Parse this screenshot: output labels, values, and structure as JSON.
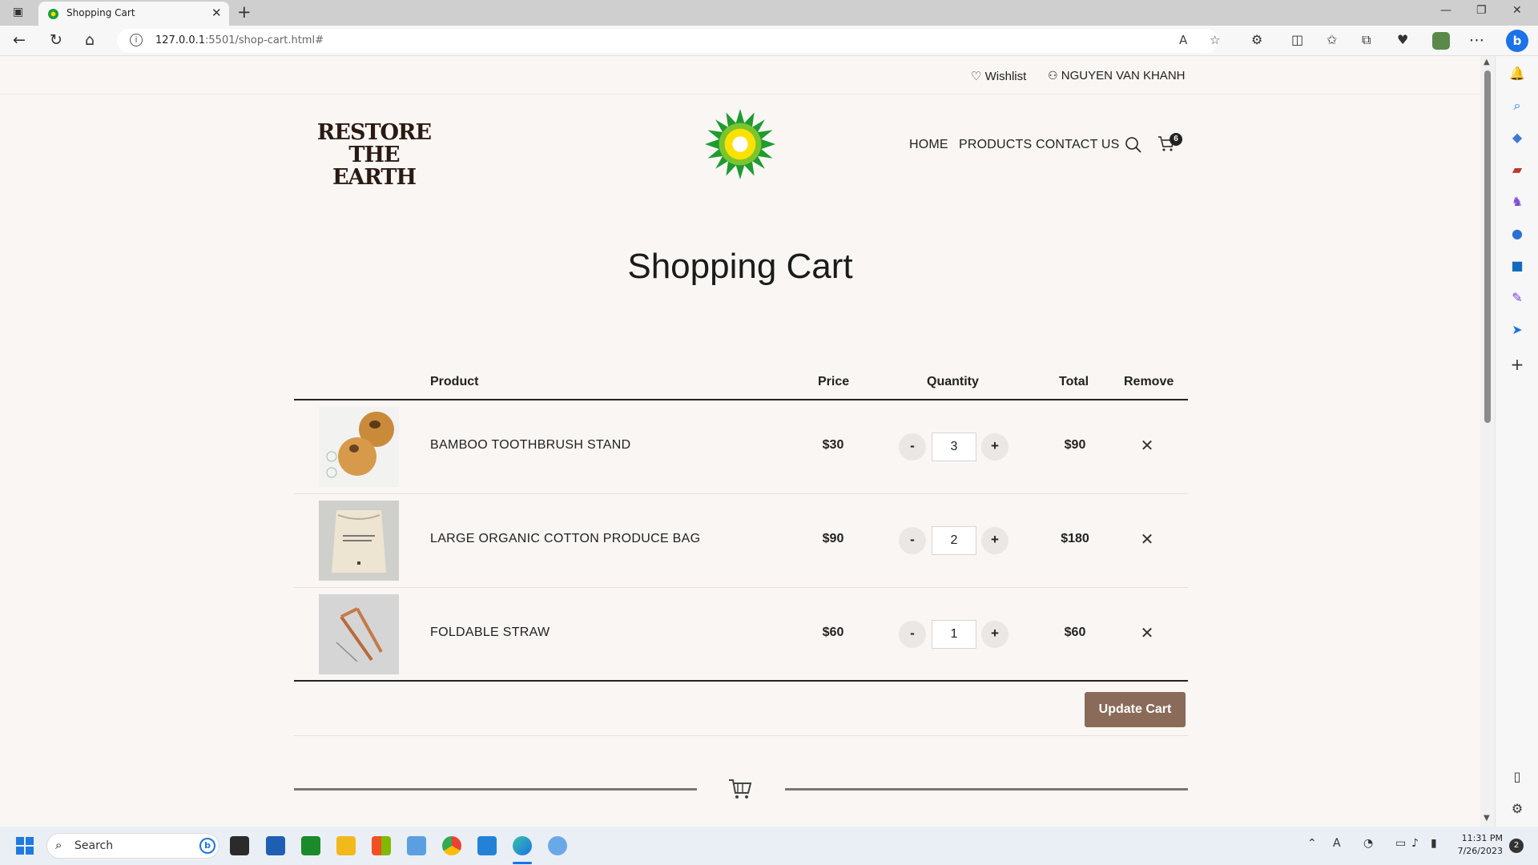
{
  "browser": {
    "tab_title": "Shopping Cart",
    "url_host": "127.0.0.1",
    "url_rest": ":5501/shop-cart.html#"
  },
  "topbar": {
    "wishlist": "Wishlist",
    "user": "NGUYEN VAN KHANH"
  },
  "brand": {
    "logo_line1": "RESTORE",
    "logo_line2": "THE EARTH"
  },
  "nav": {
    "home": "HOME",
    "products": "PRODUCTS",
    "contact": "CONTACT US",
    "cart_count": "6"
  },
  "page_title": "Shopping Cart",
  "table": {
    "headers": {
      "product": "Product",
      "price": "Price",
      "quantity": "Quantity",
      "total": "Total",
      "remove": "Remove"
    },
    "rows": [
      {
        "name": "BAMBOO TOOTHBRUSH STAND",
        "price": "$30",
        "qty": "3",
        "total": "$90"
      },
      {
        "name": "LARGE ORGANIC COTTON PRODUCE BAG",
        "price": "$90",
        "qty": "2",
        "total": "$180"
      },
      {
        "name": "FOLDABLE STRAW",
        "price": "$60",
        "qty": "1",
        "total": "$60"
      }
    ],
    "minus": "-",
    "plus": "+"
  },
  "update_button": "Update Cart",
  "taskbar": {
    "search_placeholder": "Search",
    "time": "11:31 PM",
    "date": "7/26/2023",
    "notif": "2"
  }
}
